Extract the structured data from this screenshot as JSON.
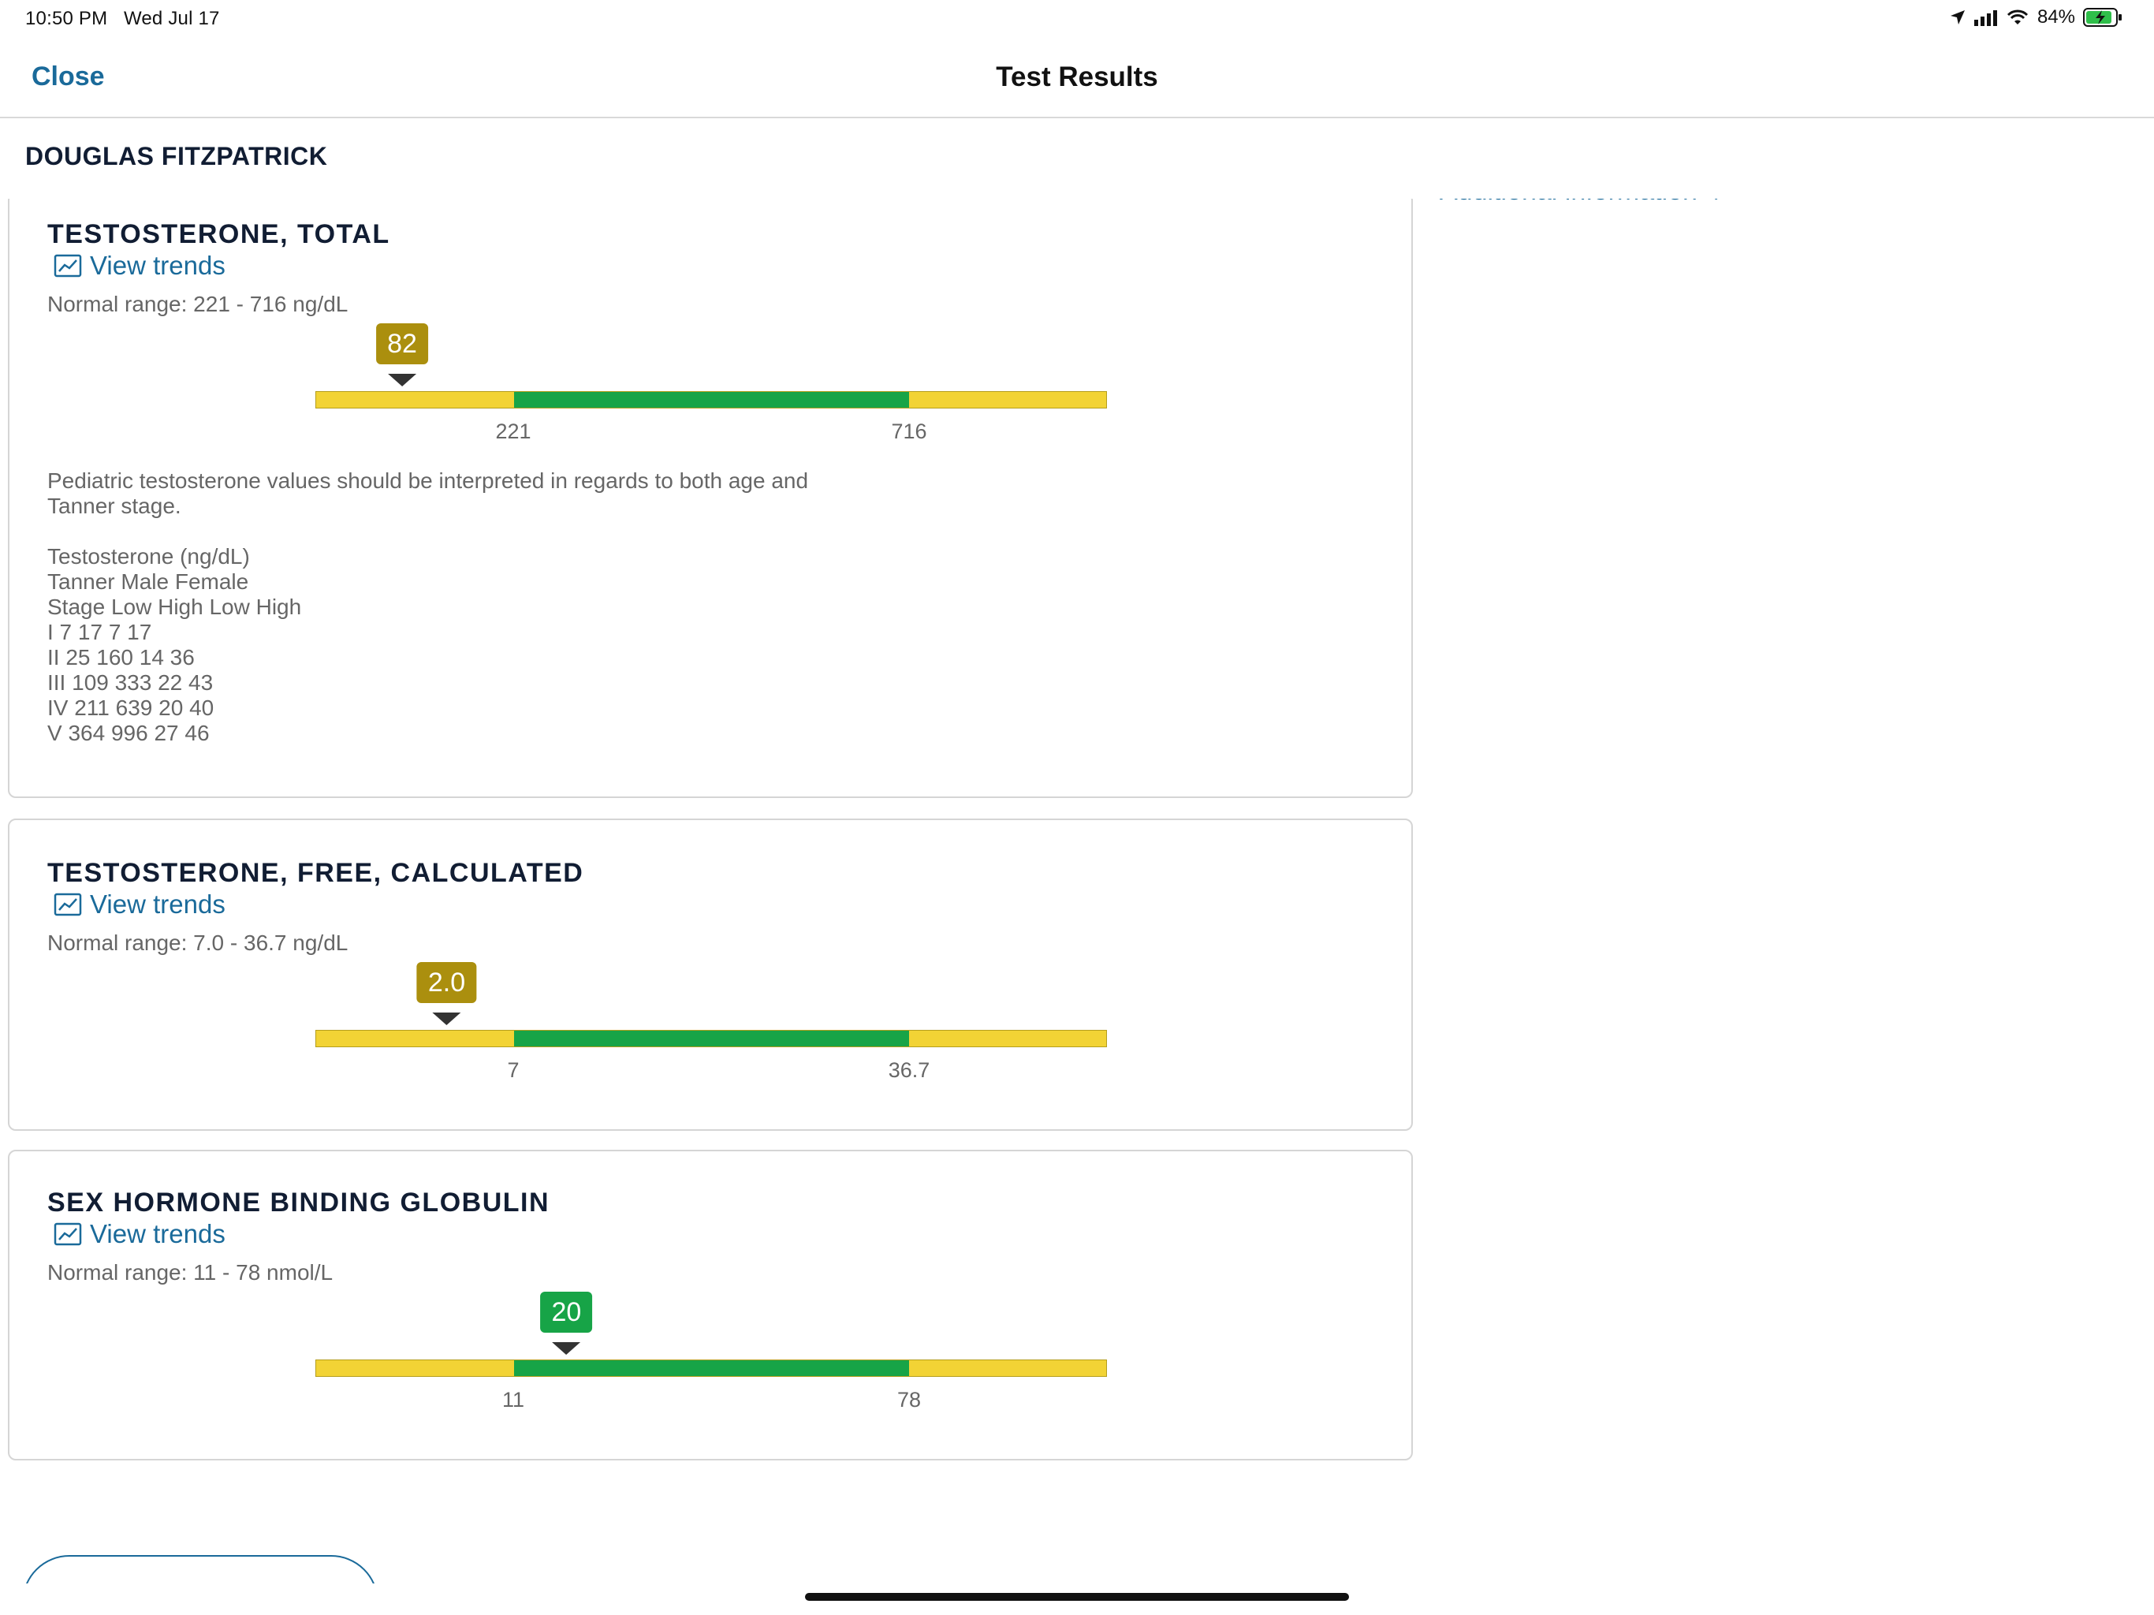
{
  "status_bar": {
    "time": "10:50 PM",
    "date": "Wed Jul 17",
    "battery": "84%"
  },
  "nav": {
    "close_label": "Close",
    "title": "Test Results"
  },
  "patient": {
    "name": "DOUGLAS FITZPATRICK"
  },
  "right_panel": {
    "link_label": "Additional information"
  },
  "colors": {
    "accent": "#1a6a9a",
    "in_range": "#17a447",
    "out_of_range_bar": "#f2d335",
    "out_of_range_badge": "#ab8f0e"
  },
  "results": [
    {
      "title": "TESTOSTERONE, TOTAL",
      "trend_label": "View trends",
      "range_text": "Normal range: 221 - 716 ng/dL",
      "value": 82,
      "value_label": "82",
      "low": 221,
      "high": 716,
      "low_label": "221",
      "high_label": "716",
      "status": "out_of_range",
      "notes": [
        "Pediatric testosterone values should be interpreted in regards to both age and",
        "Tanner stage.",
        "",
        "Testosterone (ng/dL)",
        "Tanner Male Female",
        "Stage Low High Low High",
        "I 7 17 7 17",
        "II 25 160 14 36",
        "III 109 333 22 43",
        "IV 211 639 20 40",
        "V 364 996 27 46"
      ]
    },
    {
      "title": "TESTOSTERONE, FREE, CALCULATED",
      "trend_label": "View trends",
      "range_text": "Normal range: 7.0 - 36.7 ng/dL",
      "value": 2.0,
      "value_label": "2.0",
      "low": 7,
      "high": 36.7,
      "low_label": "7",
      "high_label": "36.7",
      "status": "out_of_range"
    },
    {
      "title": "SEX HORMONE BINDING GLOBULIN",
      "trend_label": "View trends",
      "range_text": "Normal range: 11 - 78 nmol/L",
      "value": 20,
      "value_label": "20",
      "low": 11,
      "high": 78,
      "low_label": "11",
      "high_label": "78",
      "status": "in_range"
    }
  ]
}
